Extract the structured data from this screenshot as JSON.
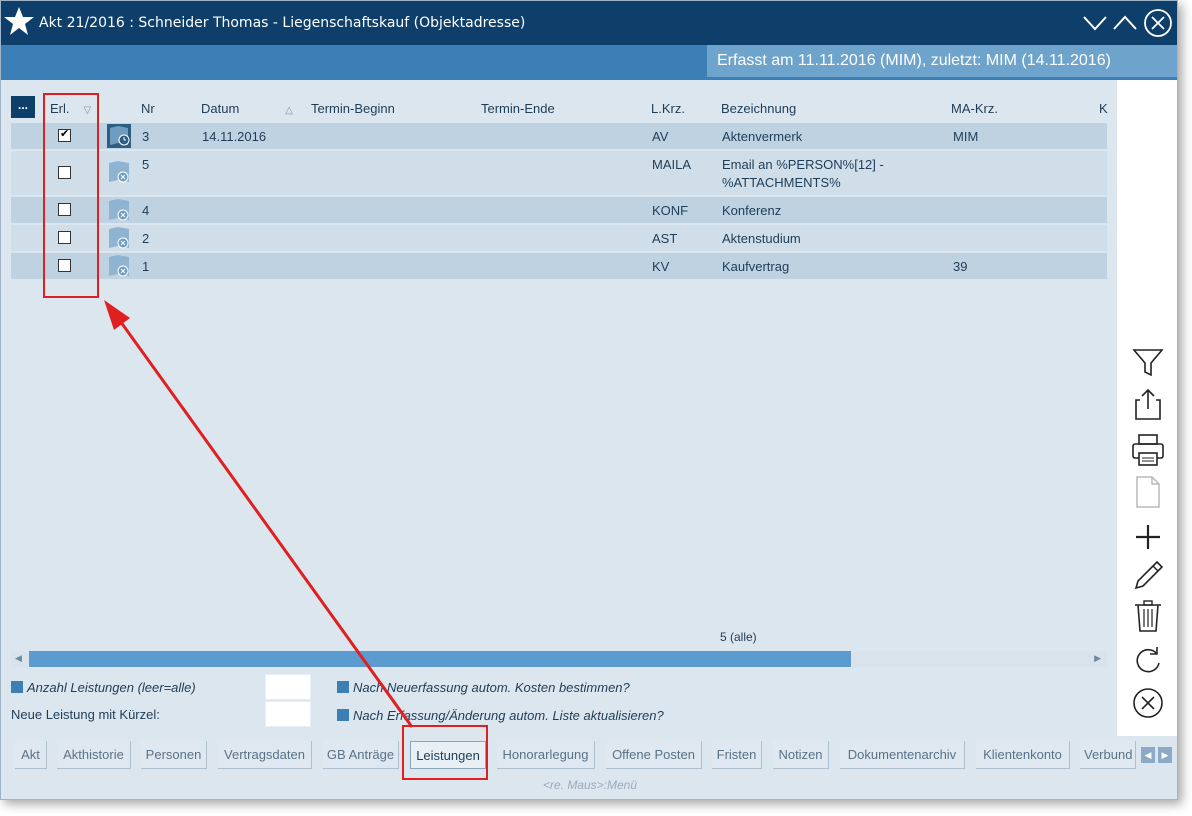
{
  "window": {
    "title": "Akt 21/2016 : Schneider Thomas - Liegenschaftskauf (Objektadresse)",
    "info": "Erfasst am 11.11.2016 (MIM), zuletzt: MIM (14.11.2016)"
  },
  "table": {
    "more_button": "...",
    "headers": {
      "erl": "Erl.",
      "nr": "Nr",
      "datum": "Datum",
      "termin_beginn": "Termin-Beginn",
      "termin_ende": "Termin-Ende",
      "lkrz": "L.Krz.",
      "bezeichnung": "Bezeichnung",
      "makrz": "MA-Krz.",
      "k": "K"
    },
    "rows": [
      {
        "checked": true,
        "nr": "3",
        "datum": "14.11.2016",
        "lkrz": "AV",
        "bez1": "Aktenvermerk",
        "bez2": "",
        "makrz": "MIM",
        "icon": "document-clock-icon"
      },
      {
        "checked": false,
        "nr": "5",
        "datum": "",
        "lkrz": "MAILA",
        "bez1": "Email an %PERSON%[12] -",
        "bez2": "%ATTACHMENTS%",
        "makrz": "",
        "icon": "document-cancel-icon"
      },
      {
        "checked": false,
        "nr": "4",
        "datum": "",
        "lkrz": "KONF",
        "bez1": "Konferenz",
        "bez2": "",
        "makrz": "",
        "icon": "document-cancel-icon"
      },
      {
        "checked": false,
        "nr": "2",
        "datum": "",
        "lkrz": "AST",
        "bez1": "Aktenstudium",
        "bez2": "",
        "makrz": "",
        "icon": "document-cancel-icon"
      },
      {
        "checked": false,
        "nr": "1",
        "datum": "",
        "lkrz": "KV",
        "bez1": "Kaufvertrag",
        "bez2": "",
        "makrz": "39",
        "icon": "document-cancel-icon"
      }
    ],
    "count": "5 (alle)"
  },
  "options": {
    "anzahl_label": "Anzahl Leistungen (leer=alle)",
    "anzahl_value": "",
    "neue_label": "Neue Leistung mit Kürzel:",
    "neue_value": "",
    "auto_kosten": "Nach Neuerfassung autom. Kosten bestimmen?",
    "auto_liste": "Nach Erfassung/Änderung autom. Liste aktualisieren?"
  },
  "tabs": [
    {
      "label": "Akt"
    },
    {
      "label": "Akthistorie"
    },
    {
      "label": "Personen"
    },
    {
      "label": "Vertragsdaten"
    },
    {
      "label": "GB Anträge"
    },
    {
      "label": "Leistungen"
    },
    {
      "label": "Honorarlegung"
    },
    {
      "label": "Offene Posten"
    },
    {
      "label": "Fristen"
    },
    {
      "label": "Notizen"
    },
    {
      "label": "Dokumentenarchiv"
    },
    {
      "label": "Klientenkonto"
    },
    {
      "label": "Verbund"
    }
  ],
  "active_tab": "Leistungen",
  "hint": "<re. Maus>:Menü",
  "toolbar_icons": [
    "filter-icon",
    "export-icon",
    "print-icon",
    "blank-document-icon",
    "add-icon",
    "edit-icon",
    "delete-icon",
    "refresh-icon",
    "close-circle-icon"
  ],
  "colors": {
    "titlebar": "#0e3f6b",
    "accent": "#3b7fb6",
    "annotation": "#e02020"
  }
}
